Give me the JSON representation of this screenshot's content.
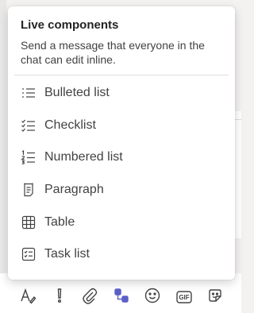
{
  "popup": {
    "title": "Live components",
    "description": "Send a message that everyone in the chat can edit inline.",
    "items": [
      {
        "label": "Bulleted list",
        "icon": "bulleted-list-icon"
      },
      {
        "label": "Checklist",
        "icon": "checklist-icon"
      },
      {
        "label": "Numbered list",
        "icon": "numbered-list-icon"
      },
      {
        "label": "Paragraph",
        "icon": "paragraph-icon"
      },
      {
        "label": "Table",
        "icon": "table-icon"
      },
      {
        "label": "Task list",
        "icon": "task-list-icon"
      }
    ]
  },
  "toolbar": {
    "gif_label": "GIF",
    "accent": "#5b5fc7",
    "buttons": [
      "format-icon",
      "priority-icon",
      "attach-icon",
      "loop-components-icon",
      "emoji-icon",
      "gif-icon",
      "sticker-icon"
    ]
  }
}
